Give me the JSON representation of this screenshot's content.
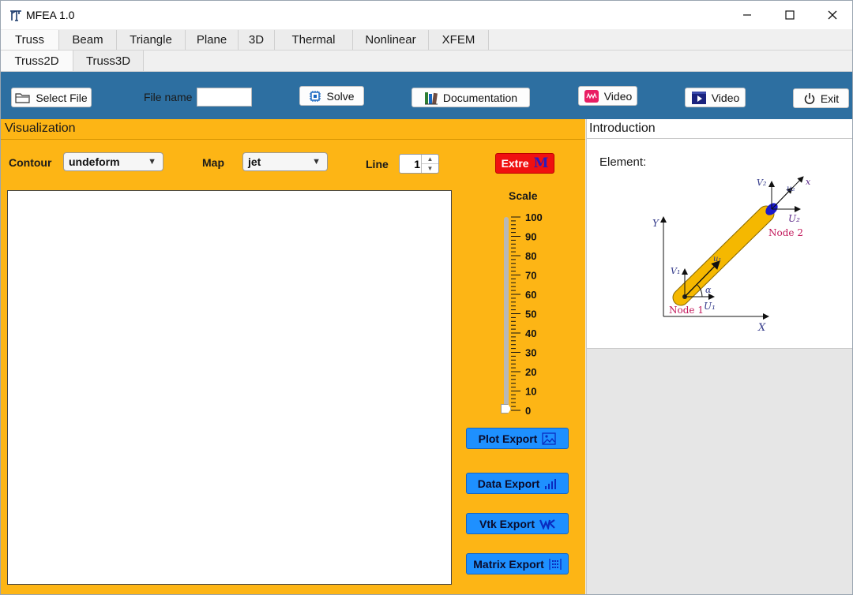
{
  "window": {
    "title": "MFEA 1.0"
  },
  "tabs": {
    "main": [
      "Truss",
      "Beam",
      "Triangle",
      "Plane",
      "3D",
      "Thermal",
      "Nonlinear",
      "XFEM"
    ],
    "active_main": "Truss",
    "sub": [
      "Truss2D",
      "Truss3D"
    ],
    "active_sub": "Truss2D"
  },
  "toolbar": {
    "select_file": "Select File",
    "file_name_label": "File name",
    "file_name_value": "",
    "solve": "Solve",
    "documentation": "Documentation",
    "video1": "Video",
    "video2": "Video",
    "exit": "Exit"
  },
  "visualization": {
    "title": "Visualization",
    "contour_label": "Contour",
    "contour_value": "undeform",
    "map_label": "Map",
    "map_value": "jet",
    "line_label": "Line",
    "line_value": "1",
    "extre_label": "Extre",
    "extre_symbol": "M",
    "scale_label": "Scale",
    "scale_ticks": [
      "100",
      "90",
      "80",
      "70",
      "60",
      "50",
      "40",
      "30",
      "20",
      "10",
      "0"
    ],
    "scale_value": 0,
    "exports": {
      "plot": "Plot Export",
      "data": "Data Export",
      "vtk": "Vtk Export",
      "matrix": "Matrix Export"
    }
  },
  "introduction": {
    "title": "Introduction",
    "element_label": "Element:",
    "diagram": {
      "axis_x": "X",
      "axis_y": "Y",
      "local_x": "x",
      "v2": "V₂",
      "u2_local": "u₂",
      "U2": "U₂",
      "node2": "Node 2",
      "u1_local": "u₁",
      "v1": "V₁",
      "alpha": "α",
      "U1": "U₁",
      "node1": "Node 1"
    }
  },
  "colors": {
    "toolbar_bg": "#2d6fa1",
    "panel_bg": "#fdb515",
    "export_btn": "#1e90ff",
    "extre_btn": "#f01010",
    "bar_fill": "#f5b800"
  }
}
